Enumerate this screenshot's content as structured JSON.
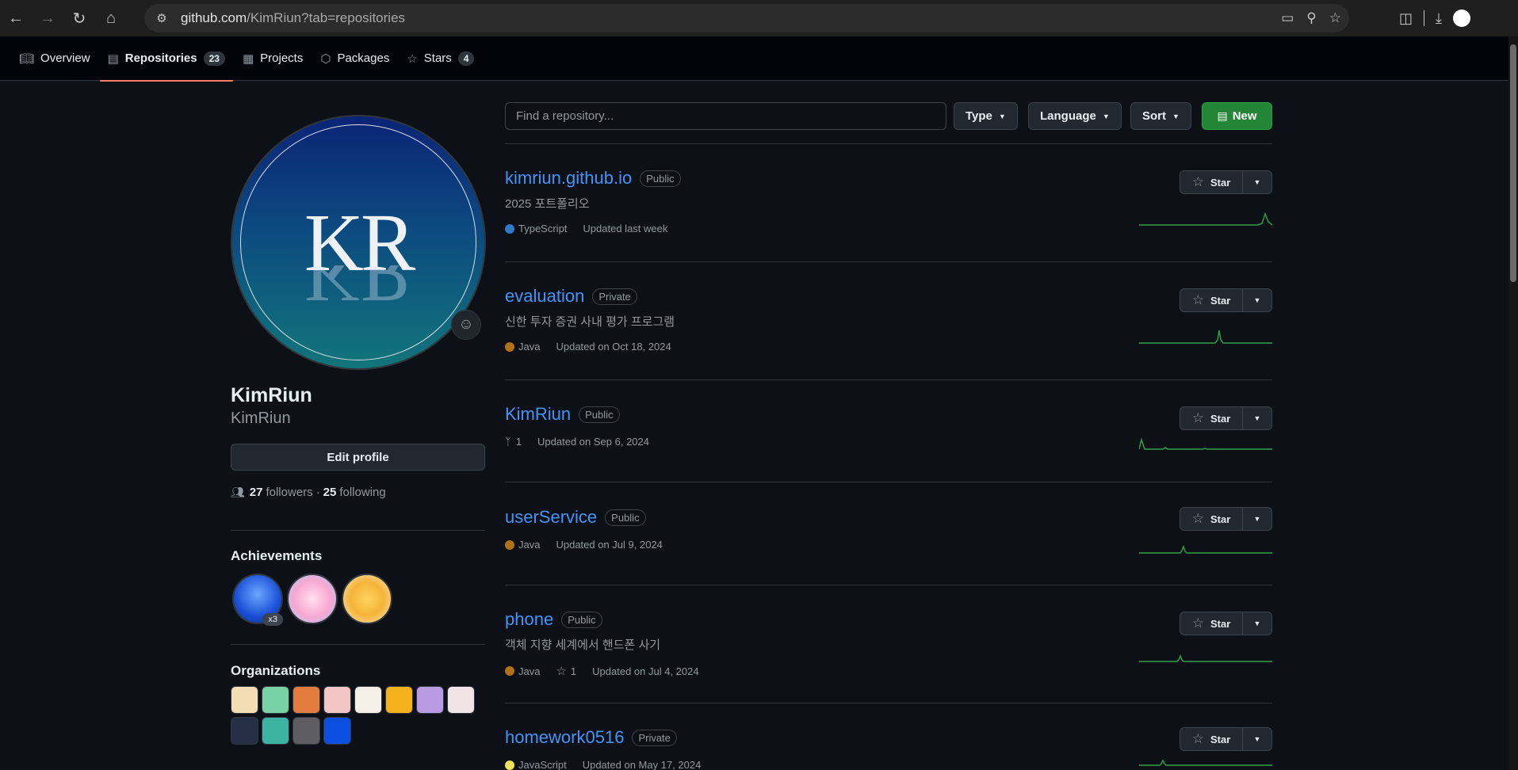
{
  "browser": {
    "url_domain": "github.com",
    "url_path": "/KimRiun?tab=repositories"
  },
  "tabs": [
    {
      "label": "Overview",
      "icon": "book-icon",
      "count": null
    },
    {
      "label": "Repositories",
      "icon": "repo-icon",
      "count": "23"
    },
    {
      "label": "Projects",
      "icon": "table-icon",
      "count": null
    },
    {
      "label": "Packages",
      "icon": "package-icon",
      "count": null
    },
    {
      "label": "Stars",
      "icon": "star-icon",
      "count": "4"
    }
  ],
  "profile": {
    "avatar_monogram": "KR",
    "display_name": "KimRiun",
    "username": "KimRiun",
    "edit_label": "Edit profile",
    "followers_count": "27",
    "followers_label": "followers",
    "following_count": "25",
    "following_label": "following",
    "separator": "·",
    "achievements_title": "Achievements",
    "achievement_multiplier": "x3",
    "organizations_title": "Organizations"
  },
  "filters": {
    "search_placeholder": "Find a repository...",
    "type_label": "Type",
    "language_label": "Language",
    "sort_label": "Sort",
    "new_label": "New"
  },
  "star_label": "Star",
  "repos": [
    {
      "name": "kimriun.github.io",
      "visibility": "Public",
      "description": "2025 포트폴리오",
      "language": "TypeScript",
      "language_color": "#3178c6",
      "forks": null,
      "stars": null,
      "updated": "Updated last week"
    },
    {
      "name": "evaluation",
      "visibility": "Private",
      "description": "신한 투자 증권 사내 평가 프로그램",
      "language": "Java",
      "language_color": "#b07219",
      "forks": null,
      "stars": null,
      "updated": "Updated on Oct 18, 2024"
    },
    {
      "name": "KimRiun",
      "visibility": "Public",
      "description": "",
      "language": null,
      "language_color": null,
      "forks": "1",
      "stars": null,
      "updated": "Updated on Sep 6, 2024"
    },
    {
      "name": "userService",
      "visibility": "Public",
      "description": "",
      "language": "Java",
      "language_color": "#b07219",
      "forks": null,
      "stars": null,
      "updated": "Updated on Jul 9, 2024"
    },
    {
      "name": "phone",
      "visibility": "Public",
      "description": "객체 지향 세계에서 핸드폰 사기",
      "language": "Java",
      "language_color": "#b07219",
      "forks": null,
      "stars": "1",
      "updated": "Updated on Jul 4, 2024"
    },
    {
      "name": "homework0516",
      "visibility": "Private",
      "description": "",
      "language": "JavaScript",
      "language_color": "#f1e05a",
      "forks": null,
      "stars": null,
      "updated": "Updated on May 17, 2024"
    }
  ],
  "colors": {
    "accent_link": "#4493f8",
    "new_button": "#238636",
    "sparkline": "#2ea043",
    "tab_underline": "#f78166"
  }
}
